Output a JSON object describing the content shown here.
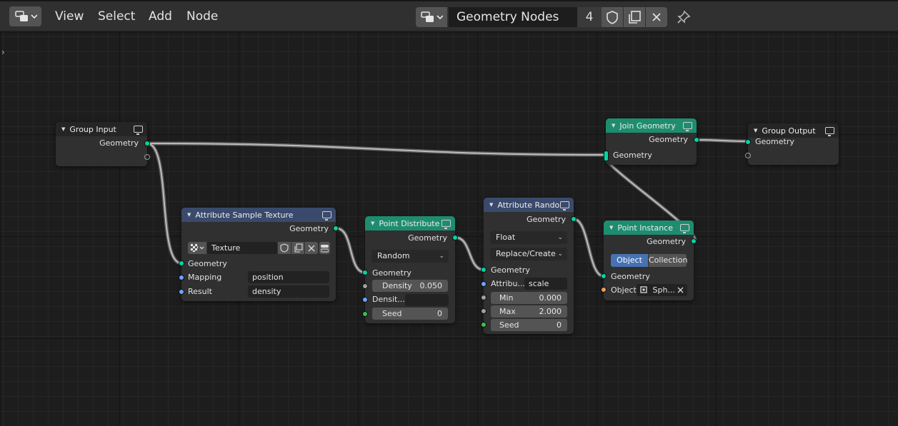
{
  "header": {
    "menus": [
      "View",
      "Select",
      "Add",
      "Node"
    ],
    "node_tree_name": "Geometry Nodes",
    "user_count": "4"
  },
  "nodes": {
    "group_input": {
      "title": "Group Input",
      "out_geometry": "Geometry"
    },
    "attribute_sample_texture": {
      "title": "Attribute Sample Texture",
      "out_geometry": "Geometry",
      "texture_name": "Texture",
      "in_geometry": "Geometry",
      "mapping_label": "Mapping",
      "mapping_value": "position",
      "result_label": "Result",
      "result_value": "density"
    },
    "point_distribute": {
      "title": "Point Distribute",
      "out_geometry": "Geometry",
      "mode": "Random",
      "in_geometry": "Geometry",
      "density_label": "Density",
      "density_value": "0.050",
      "density_attr_label": "Densit...",
      "seed_label": "Seed",
      "seed_value": "0"
    },
    "attribute_randomize": {
      "title": "Attribute Rando...",
      "out_geometry": "Geometry",
      "data_type": "Float",
      "operation": "Replace/Create",
      "in_geometry": "Geometry",
      "attribute_label": "Attribu...",
      "attribute_value": "scale",
      "min_label": "Min",
      "min_value": "0.000",
      "max_label": "Max",
      "max_value": "2.000",
      "seed_label": "Seed",
      "seed_value": "0"
    },
    "point_instance": {
      "title": "Point Instance",
      "out_geometry": "Geometry",
      "mode_object": "Object",
      "mode_collection": "Collection",
      "in_geometry": "Geometry",
      "object_label": "Object:",
      "object_value": "Sph..."
    },
    "join_geometry": {
      "title": "Join Geometry",
      "out_geometry": "Geometry",
      "in_geometry": "Geometry"
    },
    "group_output": {
      "title": "Group Output",
      "in_geometry": "Geometry"
    }
  },
  "colors": {
    "geometry_socket": "#00d6a3",
    "vector_socket": "#6aa4ff",
    "float_socket": "#a1a1a1",
    "integer_socket": "#35c24c",
    "object_socket": "#ed9e5c",
    "geometry_node_header": "#1e8d6f",
    "texture_node_header": "#3a4a6c",
    "selected_toggle": "#4772b3"
  }
}
